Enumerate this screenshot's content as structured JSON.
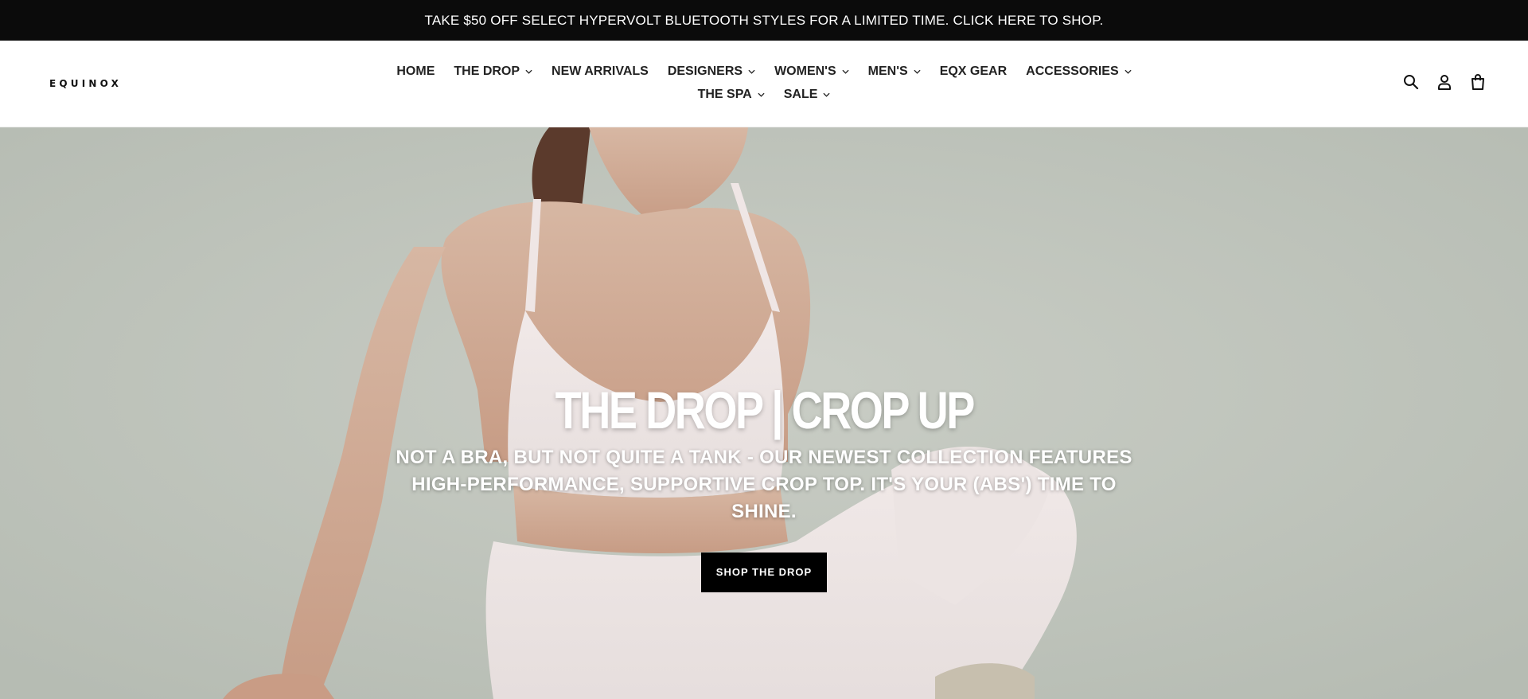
{
  "announcement": {
    "text": "TAKE $50 OFF SELECT HYPERVOLT BLUETOOTH STYLES FOR A LIMITED TIME. CLICK HERE TO SHOP."
  },
  "header": {
    "logo": "EQUINOX",
    "nav_row1": [
      {
        "label": "HOME",
        "has_dropdown": false
      },
      {
        "label": "THE DROP",
        "has_dropdown": true
      },
      {
        "label": "NEW ARRIVALS",
        "has_dropdown": false
      },
      {
        "label": "DESIGNERS",
        "has_dropdown": true
      },
      {
        "label": "WOMEN'S",
        "has_dropdown": true
      },
      {
        "label": "MEN'S",
        "has_dropdown": true
      },
      {
        "label": "EQX GEAR",
        "has_dropdown": false
      },
      {
        "label": "ACCESSORIES",
        "has_dropdown": true
      }
    ],
    "nav_row2": [
      {
        "label": "THE SPA",
        "has_dropdown": true
      },
      {
        "label": "SALE",
        "has_dropdown": true
      }
    ],
    "icons": [
      "search-icon",
      "account-icon",
      "cart-icon"
    ]
  },
  "hero": {
    "title": "THE DROP | CROP UP",
    "subtitle": "NOT A BRA, BUT NOT QUITE A TANK - OUR NEWEST COLLECTION FEATURES HIGH-PERFORMANCE, SUPPORTIVE CROP TOP. IT'S YOUR (ABS') TIME TO SHINE.",
    "button_label": "SHOP THE DROP"
  },
  "colors": {
    "announcement_bg": "#0b0b0b",
    "hero_bg": "#c1c6bd",
    "button_bg": "#000000"
  }
}
